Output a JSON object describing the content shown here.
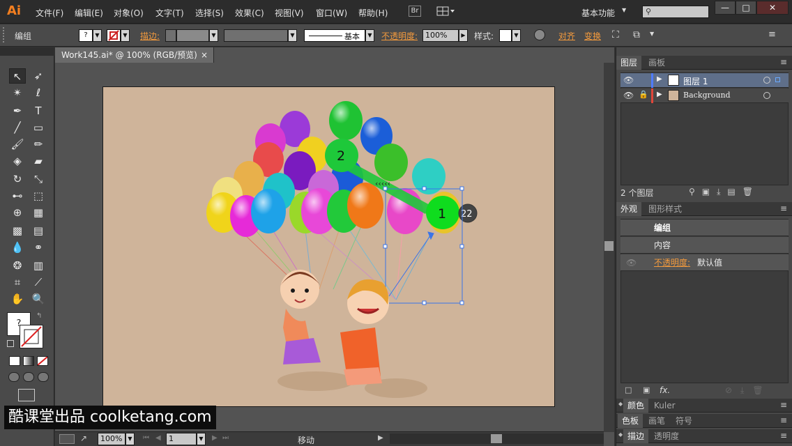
{
  "app": {
    "logo": "Ai"
  },
  "menu": [
    "文件(F)",
    "编辑(E)",
    "对象(O)",
    "文字(T)",
    "选择(S)",
    "效果(C)",
    "视图(V)",
    "窗口(W)",
    "帮助(H)"
  ],
  "menubar": {
    "bridge": "Br",
    "workspace": "基本功能",
    "search_placeholder": "",
    "win_min": "—",
    "win_max": "□",
    "win_close": "✕"
  },
  "control": {
    "selection_label": "编组",
    "stroke_label": "描边:",
    "stroke_style": "基本",
    "opacity_label": "不透明度:",
    "opacity_value": "100%",
    "style_label": "样式:",
    "align_label": "对齐",
    "transform_label": "变换"
  },
  "document": {
    "tab_title": "Work145.ai* @ 100% (RGB/预览)",
    "tab_close": "×",
    "path_label_1": "1",
    "path_label_2": "2",
    "badge": "22"
  },
  "statusbar": {
    "zoom": "100%",
    "page": "1",
    "status": "移动"
  },
  "layers_panel": {
    "tabs": [
      "图层",
      "画板"
    ],
    "rows": [
      {
        "name": "图层 1",
        "color": "#4f7cff"
      },
      {
        "name": "Background",
        "color": "#e0463a"
      }
    ],
    "footer": "2 个图层"
  },
  "appearance_panel": {
    "tabs": [
      "外观",
      "图形样式"
    ],
    "title": "编组",
    "content": "内容",
    "opacity_label": "不透明度:",
    "opacity_value": "默认值",
    "fx": "fx."
  },
  "collapsed_panels": [
    {
      "tabs": [
        "颜色",
        "Kuler"
      ]
    },
    {
      "tabs": [
        "色板",
        "画笔",
        "符号"
      ]
    },
    {
      "tabs": [
        "描边",
        "透明度"
      ]
    }
  ],
  "watermark": "酷课堂出品 coolketang.com",
  "colors": {
    "accent": "#f47f20",
    "panel": "#484848",
    "artboard": "#cfb49a"
  }
}
